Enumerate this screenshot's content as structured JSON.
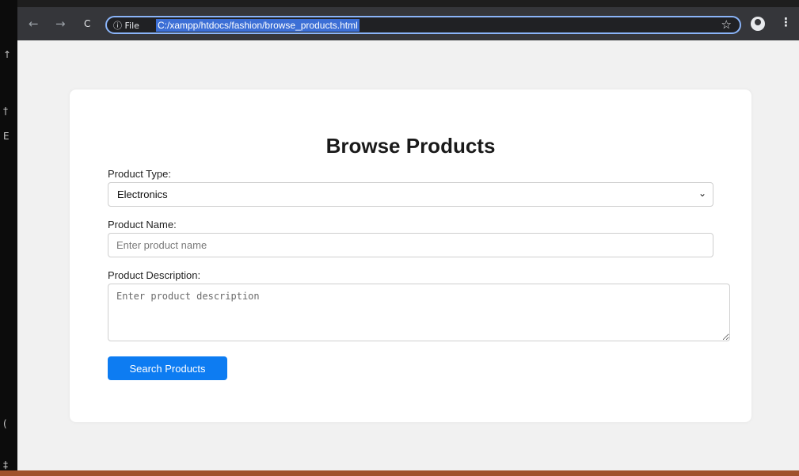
{
  "browser": {
    "back_icon": "←",
    "forward_icon": "→",
    "reload_icon": "C",
    "site_info": "ⓘ File",
    "url": "C:/xampp/htdocs/fashion/browse_products.html",
    "star_icon": "☆",
    "menu_icon": "⋮"
  },
  "page": {
    "title": "Browse Products",
    "product_type_label": "Product Type:",
    "product_type_value": "Electronics",
    "product_name_label": "Product Name:",
    "product_name_placeholder": "Enter product name",
    "product_description_label": "Product Description:",
    "product_description_placeholder": "Enter product description",
    "search_button_label": "Search Products"
  },
  "colors": {
    "accent": "#0d7cf2",
    "toolbar": "#35363a",
    "page_background": "#f1f1f1",
    "status_bar": "#a0522d"
  }
}
